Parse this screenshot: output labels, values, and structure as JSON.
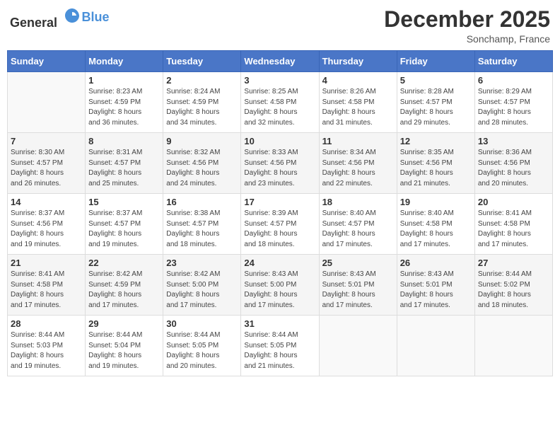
{
  "header": {
    "logo_general": "General",
    "logo_blue": "Blue",
    "month": "December 2025",
    "location": "Sonchamp, France"
  },
  "days_of_week": [
    "Sunday",
    "Monday",
    "Tuesday",
    "Wednesday",
    "Thursday",
    "Friday",
    "Saturday"
  ],
  "weeks": [
    [
      {
        "day": "",
        "info": ""
      },
      {
        "day": "1",
        "info": "Sunrise: 8:23 AM\nSunset: 4:59 PM\nDaylight: 8 hours\nand 36 minutes."
      },
      {
        "day": "2",
        "info": "Sunrise: 8:24 AM\nSunset: 4:59 PM\nDaylight: 8 hours\nand 34 minutes."
      },
      {
        "day": "3",
        "info": "Sunrise: 8:25 AM\nSunset: 4:58 PM\nDaylight: 8 hours\nand 32 minutes."
      },
      {
        "day": "4",
        "info": "Sunrise: 8:26 AM\nSunset: 4:58 PM\nDaylight: 8 hours\nand 31 minutes."
      },
      {
        "day": "5",
        "info": "Sunrise: 8:28 AM\nSunset: 4:57 PM\nDaylight: 8 hours\nand 29 minutes."
      },
      {
        "day": "6",
        "info": "Sunrise: 8:29 AM\nSunset: 4:57 PM\nDaylight: 8 hours\nand 28 minutes."
      }
    ],
    [
      {
        "day": "7",
        "info": "Sunrise: 8:30 AM\nSunset: 4:57 PM\nDaylight: 8 hours\nand 26 minutes."
      },
      {
        "day": "8",
        "info": "Sunrise: 8:31 AM\nSunset: 4:57 PM\nDaylight: 8 hours\nand 25 minutes."
      },
      {
        "day": "9",
        "info": "Sunrise: 8:32 AM\nSunset: 4:56 PM\nDaylight: 8 hours\nand 24 minutes."
      },
      {
        "day": "10",
        "info": "Sunrise: 8:33 AM\nSunset: 4:56 PM\nDaylight: 8 hours\nand 23 minutes."
      },
      {
        "day": "11",
        "info": "Sunrise: 8:34 AM\nSunset: 4:56 PM\nDaylight: 8 hours\nand 22 minutes."
      },
      {
        "day": "12",
        "info": "Sunrise: 8:35 AM\nSunset: 4:56 PM\nDaylight: 8 hours\nand 21 minutes."
      },
      {
        "day": "13",
        "info": "Sunrise: 8:36 AM\nSunset: 4:56 PM\nDaylight: 8 hours\nand 20 minutes."
      }
    ],
    [
      {
        "day": "14",
        "info": "Sunrise: 8:37 AM\nSunset: 4:56 PM\nDaylight: 8 hours\nand 19 minutes."
      },
      {
        "day": "15",
        "info": "Sunrise: 8:37 AM\nSunset: 4:57 PM\nDaylight: 8 hours\nand 19 minutes."
      },
      {
        "day": "16",
        "info": "Sunrise: 8:38 AM\nSunset: 4:57 PM\nDaylight: 8 hours\nand 18 minutes."
      },
      {
        "day": "17",
        "info": "Sunrise: 8:39 AM\nSunset: 4:57 PM\nDaylight: 8 hours\nand 18 minutes."
      },
      {
        "day": "18",
        "info": "Sunrise: 8:40 AM\nSunset: 4:57 PM\nDaylight: 8 hours\nand 17 minutes."
      },
      {
        "day": "19",
        "info": "Sunrise: 8:40 AM\nSunset: 4:58 PM\nDaylight: 8 hours\nand 17 minutes."
      },
      {
        "day": "20",
        "info": "Sunrise: 8:41 AM\nSunset: 4:58 PM\nDaylight: 8 hours\nand 17 minutes."
      }
    ],
    [
      {
        "day": "21",
        "info": "Sunrise: 8:41 AM\nSunset: 4:58 PM\nDaylight: 8 hours\nand 17 minutes."
      },
      {
        "day": "22",
        "info": "Sunrise: 8:42 AM\nSunset: 4:59 PM\nDaylight: 8 hours\nand 17 minutes."
      },
      {
        "day": "23",
        "info": "Sunrise: 8:42 AM\nSunset: 5:00 PM\nDaylight: 8 hours\nand 17 minutes."
      },
      {
        "day": "24",
        "info": "Sunrise: 8:43 AM\nSunset: 5:00 PM\nDaylight: 8 hours\nand 17 minutes."
      },
      {
        "day": "25",
        "info": "Sunrise: 8:43 AM\nSunset: 5:01 PM\nDaylight: 8 hours\nand 17 minutes."
      },
      {
        "day": "26",
        "info": "Sunrise: 8:43 AM\nSunset: 5:01 PM\nDaylight: 8 hours\nand 17 minutes."
      },
      {
        "day": "27",
        "info": "Sunrise: 8:44 AM\nSunset: 5:02 PM\nDaylight: 8 hours\nand 18 minutes."
      }
    ],
    [
      {
        "day": "28",
        "info": "Sunrise: 8:44 AM\nSunset: 5:03 PM\nDaylight: 8 hours\nand 19 minutes."
      },
      {
        "day": "29",
        "info": "Sunrise: 8:44 AM\nSunset: 5:04 PM\nDaylight: 8 hours\nand 19 minutes."
      },
      {
        "day": "30",
        "info": "Sunrise: 8:44 AM\nSunset: 5:05 PM\nDaylight: 8 hours\nand 20 minutes."
      },
      {
        "day": "31",
        "info": "Sunrise: 8:44 AM\nSunset: 5:05 PM\nDaylight: 8 hours\nand 21 minutes."
      },
      {
        "day": "",
        "info": ""
      },
      {
        "day": "",
        "info": ""
      },
      {
        "day": "",
        "info": ""
      }
    ]
  ]
}
